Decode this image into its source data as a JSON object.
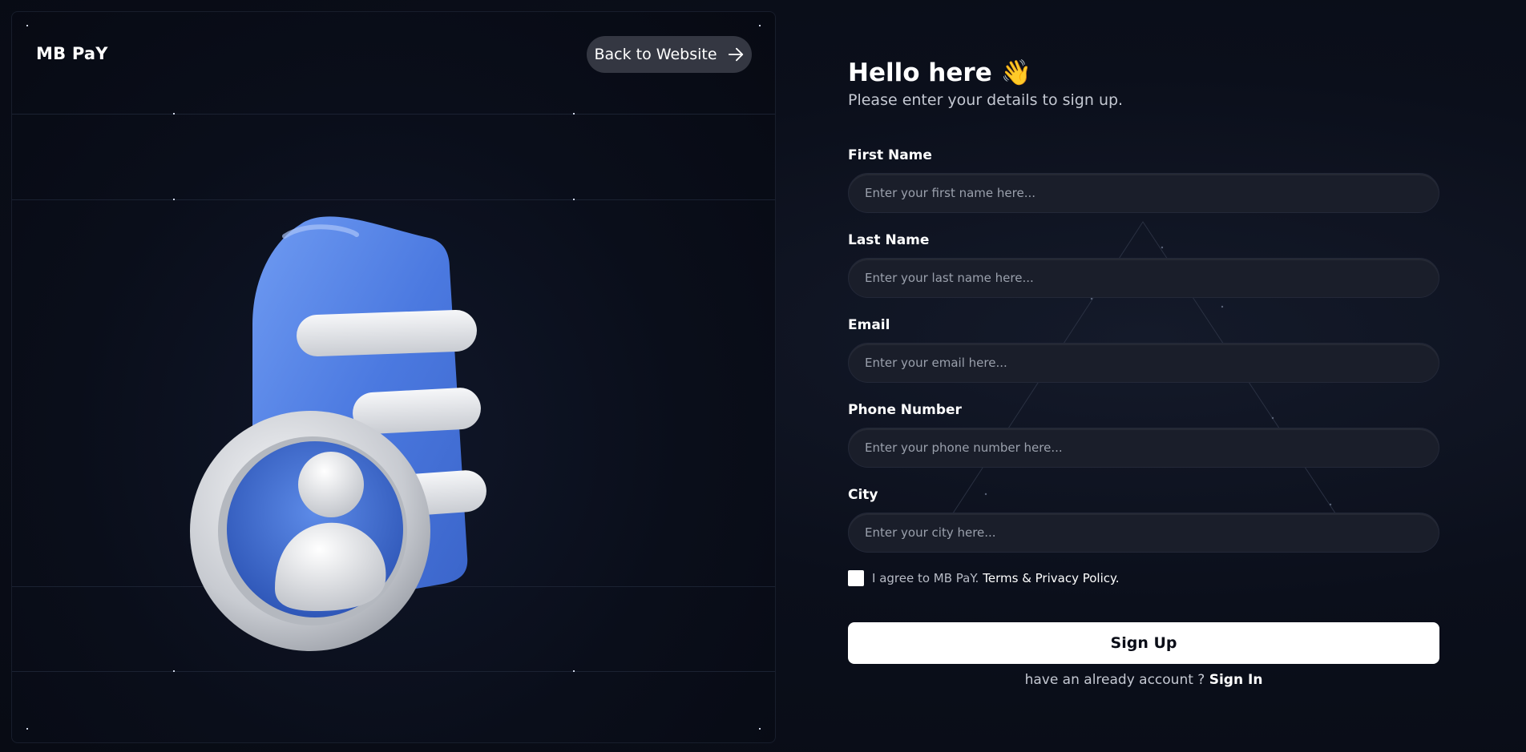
{
  "brand": {
    "name": "MB PaY"
  },
  "header": {
    "back_label": "Back to Website",
    "back_icon": "arrow-right-icon"
  },
  "illustration": {
    "icon": "user-document-3d-icon"
  },
  "form": {
    "title": "Hello here 👋",
    "subtitle": "Please enter your details to sign up.",
    "fields": [
      {
        "label": "First Name",
        "placeholder": "Enter your first name here...",
        "value": ""
      },
      {
        "label": "Last Name",
        "placeholder": "Enter your last name here...",
        "value": ""
      },
      {
        "label": "Email",
        "placeholder": "Enter your email here...",
        "value": ""
      },
      {
        "label": "Phone Number",
        "placeholder": "Enter your phone number here...",
        "value": ""
      },
      {
        "label": "City",
        "placeholder": "Enter your city here...",
        "value": ""
      }
    ],
    "agree_text": "I agree to MB PaY.",
    "terms_link": "Terms & Privacy Policy.",
    "agree_checked": false,
    "submit_label": "Sign Up",
    "signin_prompt": "have an already account ?",
    "signin_link": "Sign In"
  },
  "colors": {
    "background": "#0a0d17",
    "input_bg": "#1a1e2a",
    "button_bg": "#ffffff",
    "back_button_bg": "#343742",
    "illustration_blue": "#4a7be0"
  }
}
